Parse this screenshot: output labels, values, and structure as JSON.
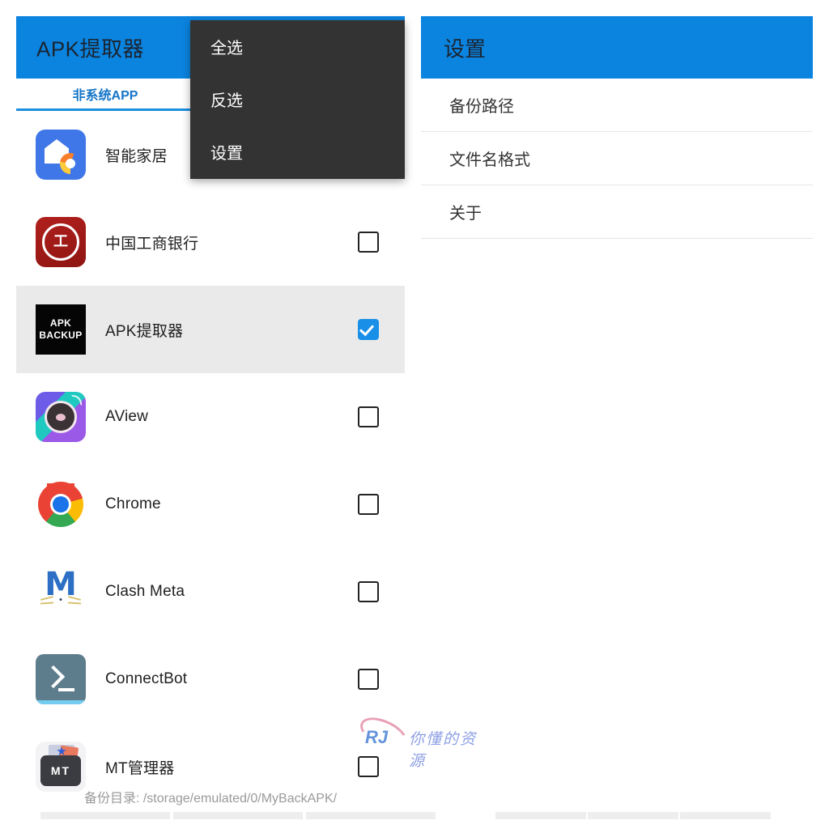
{
  "left_pane": {
    "appbar_title": "APK提取器",
    "tab_label": "非系统APP",
    "footer_path": "备份目录: /storage/emulated/0/MyBackAPK/",
    "apps": [
      {
        "name": "智能家居",
        "icon": "smart-home-icon",
        "checked": false,
        "selected": false
      },
      {
        "name": "中国工商银行",
        "icon": "icbc-bank-icon",
        "checked": false,
        "selected": false
      },
      {
        "name": "APK提取器",
        "icon": "apk-backup-icon",
        "icon_line1": "APK",
        "icon_line2": "BACKUP",
        "checked": true,
        "selected": true
      },
      {
        "name": "AView",
        "icon": "aview-camera-icon",
        "checked": false,
        "selected": false
      },
      {
        "name": "Chrome",
        "icon": "chrome-icon",
        "checked": false,
        "selected": false
      },
      {
        "name": "Clash Meta",
        "icon": "clash-meta-icon",
        "checked": false,
        "selected": false
      },
      {
        "name": "ConnectBot",
        "icon": "connectbot-terminal-icon",
        "checked": false,
        "selected": false
      },
      {
        "name": "MT管理器",
        "icon": "mt-manager-icon",
        "icon_text": "MT",
        "checked": false,
        "selected": false
      }
    ]
  },
  "dropdown_menu": {
    "items": [
      {
        "label": "全选"
      },
      {
        "label": "反选"
      },
      {
        "label": "设置"
      }
    ]
  },
  "right_pane": {
    "appbar_title": "设置",
    "settings": [
      {
        "label": "备份路径"
      },
      {
        "label": "文件名格式"
      },
      {
        "label": "关于"
      }
    ]
  },
  "watermark": {
    "logo": "RJ",
    "text": "你懂的资源"
  },
  "colors": {
    "accent_blue": "#0b84e0",
    "checkbox_blue": "#1a8fe8",
    "menu_bg": "#333333",
    "selected_row": "#eaeaea",
    "tab_text": "#1575c8"
  }
}
